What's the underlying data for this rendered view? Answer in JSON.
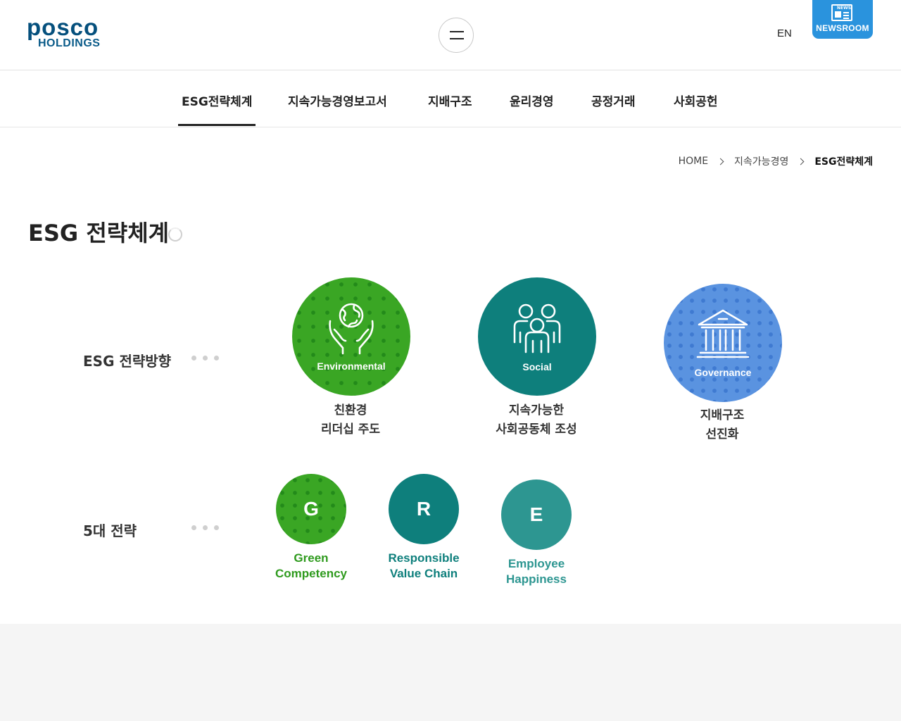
{
  "header": {
    "logo_top": "posco",
    "logo_bottom": "HOLDINGS",
    "language": "EN",
    "newsroom_label": "NEWSROOM",
    "newsroom_icon_text": "NEWS"
  },
  "subnav": {
    "tabs": [
      {
        "label": "ESG전략체계",
        "active": true
      },
      {
        "label": "지속가능경영보고서",
        "active": false
      },
      {
        "label": "지배구조",
        "active": false
      },
      {
        "label": "윤리경영",
        "active": false
      },
      {
        "label": "공정거래",
        "active": false
      },
      {
        "label": "사회공헌",
        "active": false
      }
    ]
  },
  "breadcrumb": {
    "home": "HOME",
    "level1": "지속가능경영",
    "current": "ESG전략체계"
  },
  "page": {
    "title": "ESG 전략체계"
  },
  "directions": {
    "row_label": "ESG 전략방향",
    "items": [
      {
        "icon": "hands-globe-icon",
        "badge": "Environmental",
        "caption_line1": "친환경",
        "caption_line2": "리더십 주도",
        "color": "#3aa624"
      },
      {
        "icon": "people-group-icon",
        "badge": "Social",
        "caption_line1": "지속가능한",
        "caption_line2": "사회공동체 조성",
        "color": "#0e7f7c"
      },
      {
        "icon": "government-building-icon",
        "badge": "Governance",
        "caption_line1": "지배구조",
        "caption_line2": "선진화",
        "color": "#5a93e0"
      }
    ]
  },
  "strategies": {
    "row_label": "5대 전략",
    "items": [
      {
        "letter": "G",
        "line1": "Green",
        "line2": "Competency",
        "color": "#3aa624"
      },
      {
        "letter": "R",
        "line1": "Responsible",
        "line2": "Value Chain",
        "color": "#0e7f7c"
      },
      {
        "letter": "E",
        "line1": "Employee",
        "line2": "Happiness",
        "color": "#2d9691"
      }
    ]
  }
}
